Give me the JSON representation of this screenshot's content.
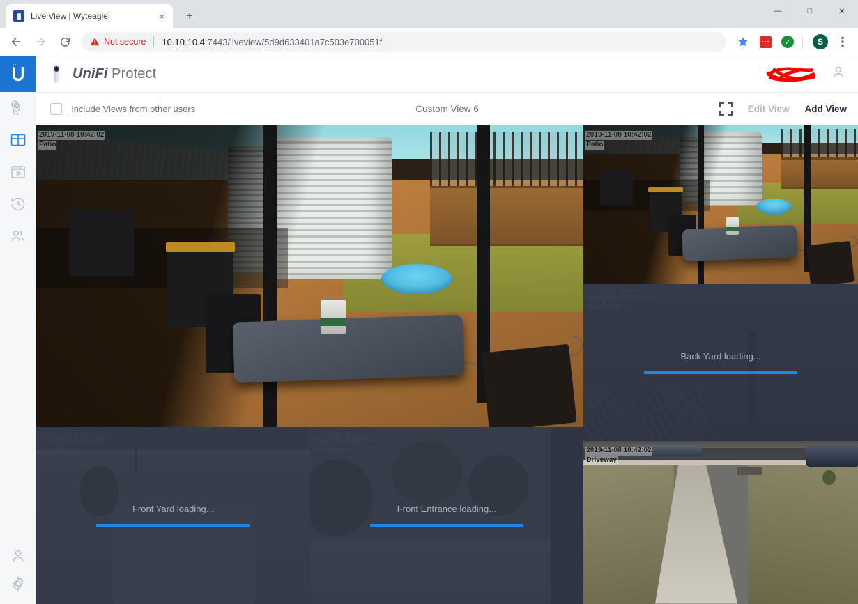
{
  "browser": {
    "tab": {
      "title": "Live View | Wyteagle",
      "favicon": "camera-favicon",
      "close": "×"
    },
    "new_tab": "+",
    "window_controls": {
      "minimize": "—",
      "maximize": "□",
      "close": "✕"
    },
    "nav": {
      "back": "←",
      "forward": "→",
      "reload": "↻"
    },
    "omnibox": {
      "security_label": "Not secure",
      "url_host": "10.10.10.4",
      "url_rest": ":7443/liveview/5d9d633401a7c503e700051f",
      "url_full": "10.10.10.4:7443/liveview/5d9d633401a7c503e700051f"
    },
    "toolbar_icons": [
      {
        "name": "bookmark-star-icon",
        "glyph": "★",
        "color": "#4285f4"
      },
      {
        "name": "extension-red-icon",
        "color": "#d93025"
      },
      {
        "name": "extension-check-icon",
        "glyph": "✓",
        "color": "#1e8e3e"
      },
      {
        "name": "profile-avatar",
        "letter": "S",
        "color": "#0b5c4a"
      },
      {
        "name": "chrome-menu-icon",
        "glyph": "⋮"
      }
    ]
  },
  "sidebar": {
    "logo": "unifi-logo",
    "items": [
      {
        "name": "sidebar-item-cameras",
        "icon": "camera-icon",
        "active": false
      },
      {
        "name": "sidebar-item-liveview",
        "icon": "grid-icon",
        "active": true
      },
      {
        "name": "sidebar-item-recordings",
        "icon": "video-play-icon",
        "active": false
      },
      {
        "name": "sidebar-item-timeline",
        "icon": "history-clock-icon",
        "active": false
      },
      {
        "name": "sidebar-item-users",
        "icon": "users-icon",
        "active": false
      }
    ],
    "bottom_items": [
      {
        "name": "sidebar-item-account",
        "icon": "person-icon"
      },
      {
        "name": "sidebar-item-settings",
        "icon": "gear-icon"
      }
    ]
  },
  "app_header": {
    "product_unifi": "UniFi",
    "product_protect": "Protect",
    "camera_icon": "unifi-camera-icon",
    "redaction": "red-scribble-redaction",
    "user_icon": "user-account-icon"
  },
  "view_bar": {
    "checkbox_label": "Include Views from other users",
    "checkbox_checked": false,
    "view_title": "Custom View 6",
    "fullscreen_icon": "expand-fullscreen-icon",
    "edit_view_label": "Edit View",
    "add_view_label": "Add View"
  },
  "accent_colors": {
    "unifi_blue": "#1b87e6",
    "logo_blue": "#1b75d0",
    "not_secure_red": "#c5221f",
    "progress_blue": "#1b87e6"
  },
  "cameras": [
    {
      "id": "patio-main",
      "name": "Patio",
      "timestamp": "2019-11-08 10:42:02",
      "state": "live",
      "scene": "patio"
    },
    {
      "id": "patio-small",
      "name": "Patio",
      "timestamp": "2019-11-08 10:42:02",
      "state": "live",
      "scene": "patio"
    },
    {
      "id": "back-yard",
      "name": "Back Yard",
      "timestamp": "2019-11-08 10:40:55",
      "state": "loading",
      "loading_text": "Back Yard loading...",
      "scene": "backyard"
    },
    {
      "id": "front-yard",
      "name": "Front Yard",
      "timestamp": "2019-11-08 10:40:54",
      "state": "loading",
      "loading_text": "Front Yard loading...",
      "scene": "frontyard"
    },
    {
      "id": "front-entrance",
      "name": "Front Entrance",
      "timestamp": "2019-11-08 10:40:59",
      "state": "loading",
      "loading_text": "Front Entrance loading...",
      "scene": "frontentrance"
    },
    {
      "id": "driveway",
      "name": "Driveway",
      "timestamp": "2019-11-08 10:42:02",
      "state": "live",
      "scene": "driveway"
    }
  ]
}
